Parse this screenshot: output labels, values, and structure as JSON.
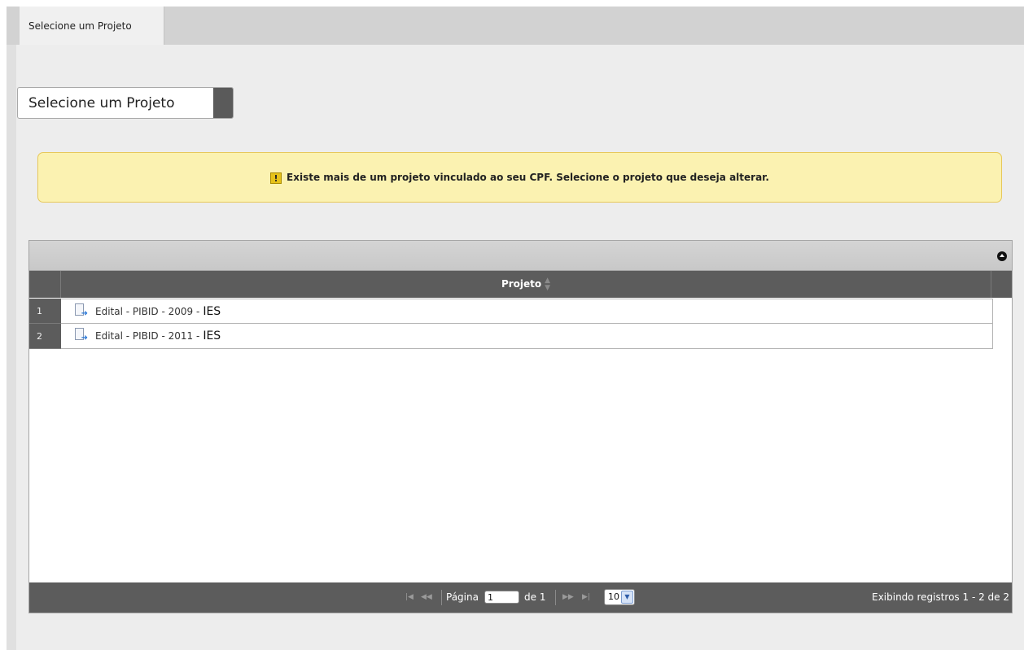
{
  "tabs": [
    {
      "label": "Selecione um Projeto"
    }
  ],
  "page": {
    "title": "Selecione um Projeto"
  },
  "alert": {
    "icon": "warning-icon",
    "message": "Existe mais de um projeto vinculado ao seu CPF. Selecione o projeto que deseja alterar."
  },
  "grid": {
    "columns": [
      {
        "label": "Projeto",
        "sortable": true
      }
    ],
    "rows": [
      {
        "num": "1",
        "text": "Edital - PIBID - 2009 -",
        "institution": "IES",
        "icon": "document-arrow-icon"
      },
      {
        "num": "2",
        "text": "Edital - PIBID - 2011 -",
        "institution": "IES",
        "icon": "document-arrow-icon"
      }
    ],
    "pager": {
      "page_label": "Página",
      "current_page": "1",
      "of_label": "de 1",
      "page_size": "10",
      "records_info": "Exibindo registros 1 - 2 de 2"
    }
  }
}
